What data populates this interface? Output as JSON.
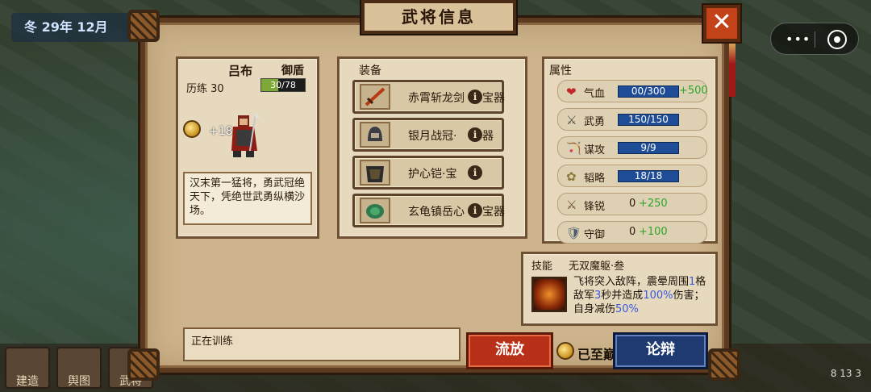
{
  "status": {
    "date": "冬 29年 12月",
    "clock": "8 13 3"
  },
  "bottom_bar": [
    "建造",
    "舆图",
    "武将",
    "",
    "",
    "",
    "",
    "",
    "",
    "",
    "",
    ""
  ],
  "panel": {
    "title": "武将信息",
    "close_label": "✕",
    "general": {
      "name": "吕布",
      "role": "御盾",
      "exp_label": "历练 30",
      "exp_text": "30/78",
      "exp_fraction": 0.385,
      "bonus": "+18",
      "description": "汉末第一猛将，勇武冠绝天下，凭绝世武勇纵横沙场。"
    },
    "equipment": {
      "title": "装备",
      "items": [
        {
          "name": "赤霄斩龙剑",
          "suffix": "宝器",
          "info": "i",
          "icon": "sword-icon"
        },
        {
          "name": "银月战冠·",
          "suffix": "器",
          "info": "i",
          "icon": "helmet-icon"
        },
        {
          "name": "护心铠·宝",
          "suffix": "",
          "info": "i",
          "icon": "armor-icon"
        },
        {
          "name": "玄龟镇岳心",
          "suffix": "宝器",
          "info": "i",
          "icon": "turtle-icon"
        }
      ]
    },
    "attributes": {
      "title": "属性",
      "rows": [
        {
          "icon": "❤",
          "name": "气血",
          "base": "00/300",
          "bonus": "+500",
          "bar": true
        },
        {
          "icon": "⚔",
          "name": "武勇",
          "base": "150/150",
          "bonus": "",
          "bar": true
        },
        {
          "icon": "🏹",
          "name": "谋攻",
          "base": "9/9",
          "bonus": "",
          "bar": true
        },
        {
          "icon": "✿",
          "name": "韬略",
          "base": "18/18",
          "bonus": "",
          "bar": true
        },
        {
          "icon": "⚔",
          "name": "锋锐",
          "base": "0",
          "bonus": "+250",
          "bar": false
        },
        {
          "icon": "🛡",
          "name": "守御",
          "base": "0",
          "bonus": "+100",
          "bar": false
        }
      ]
    },
    "skill": {
      "label": "技能",
      "name": "无双魔躯·叁",
      "text_a": "飞将突入敌阵，震晕周围",
      "num_a": "1",
      "text_b": "格敌军",
      "num_b": "3",
      "text_c": "秒并造成",
      "num_c": "100%",
      "text_d": "伤害；自身减伤",
      "num_d": "50%"
    },
    "training": "正在训练",
    "exile_button": "流放",
    "peak_label": "已至巅峰",
    "debate_button": "论辩"
  }
}
